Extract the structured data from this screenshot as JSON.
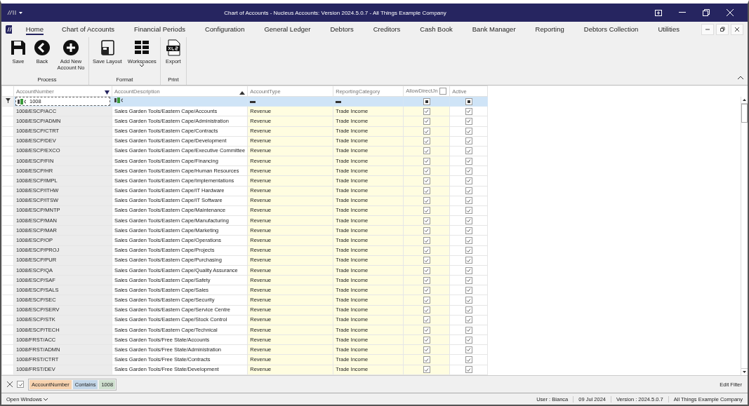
{
  "window": {
    "title": "Chart of Accounts - Nucleus Accounts: Version 2024.5.0.7 - All Things Example Company"
  },
  "menu_tabs": [
    {
      "label": "Home",
      "selected": true
    },
    {
      "label": "Chart of Accounts",
      "selected": false
    },
    {
      "label": "Financial Periods",
      "selected": false
    },
    {
      "label": "Configuration",
      "selected": false
    },
    {
      "label": "General Ledger",
      "selected": false
    },
    {
      "label": "Debtors",
      "selected": false
    },
    {
      "label": "Creditors",
      "selected": false
    },
    {
      "label": "Cash Book",
      "selected": false
    },
    {
      "label": "Bank Manager",
      "selected": false
    },
    {
      "label": "Reporting",
      "selected": false
    },
    {
      "label": "Debtors Collection",
      "selected": false
    },
    {
      "label": "Utilities",
      "selected": false
    }
  ],
  "ribbon_groups": [
    {
      "label": "Process",
      "buttons": [
        {
          "label": "Save",
          "dropdown": false
        },
        {
          "label": "Back",
          "dropdown": false
        },
        {
          "label": "Add New Account No",
          "dropdown": false
        }
      ]
    },
    {
      "label": "Format",
      "buttons": [
        {
          "label": "Save Layout",
          "dropdown": false
        },
        {
          "label": "Workspaces",
          "dropdown": true
        }
      ]
    },
    {
      "label": "Print",
      "buttons": [
        {
          "label": "Export",
          "dropdown": false
        }
      ]
    }
  ],
  "table": {
    "columns": [
      {
        "label": "AccountNumber",
        "filter": "1008",
        "filtered": true,
        "sorted": false
      },
      {
        "label": "AccountDescription",
        "filtered": false,
        "sorted": true
      },
      {
        "label": "AccountType",
        "filtered": false,
        "sorted": false
      },
      {
        "label": "ReportingCategory",
        "filtered": false,
        "sorted": false
      },
      {
        "label": "AllowDirectJn",
        "filtered": false,
        "sorted": false,
        "header_checkbox": {
          "checked": false
        },
        "filter_indeterminate": true
      },
      {
        "label": "Active",
        "filtered": false,
        "sorted": false,
        "filter_indeterminate": true
      }
    ],
    "rows": [
      {
        "number": "1008/ESCP/ACC",
        "description": "Sales Garden Tools/Eastern Cape/Accounts",
        "type": "Revenue",
        "category": "Trade Income",
        "allow_direct": true,
        "active": true
      },
      {
        "number": "1008/ESCP/ADMN",
        "description": "Sales Garden Tools/Eastern Cape/Administration",
        "type": "Revenue",
        "category": "Trade Income",
        "allow_direct": true,
        "active": true
      },
      {
        "number": "1008/ESCP/CTRT",
        "description": "Sales Garden Tools/Eastern Cape/Contracts",
        "type": "Revenue",
        "category": "Trade Income",
        "allow_direct": true,
        "active": true
      },
      {
        "number": "1008/ESCP/DEV",
        "description": "Sales Garden Tools/Eastern Cape/Development",
        "type": "Revenue",
        "category": "Trade Income",
        "allow_direct": true,
        "active": true
      },
      {
        "number": "1008/ESCP/EXCO",
        "description": "Sales Garden Tools/Eastern Cape/Executive Committee",
        "type": "Revenue",
        "category": "Trade Income",
        "allow_direct": true,
        "active": true
      },
      {
        "number": "1008/ESCP/FIN",
        "description": "Sales Garden Tools/Eastern Cape/Financing",
        "type": "Revenue",
        "category": "Trade Income",
        "allow_direct": true,
        "active": true
      },
      {
        "number": "1008/ESCP/HR",
        "description": "Sales Garden Tools/Eastern Cape/Human Resources",
        "type": "Revenue",
        "category": "Trade Income",
        "allow_direct": true,
        "active": true
      },
      {
        "number": "1008/ESCP/IMPL",
        "description": "Sales Garden Tools/Eastern Cape/Implementations",
        "type": "Revenue",
        "category": "Trade Income",
        "allow_direct": true,
        "active": true
      },
      {
        "number": "1008/ESCP/ITHW",
        "description": "Sales Garden Tools/Eastern Cape/IT Hardware",
        "type": "Revenue",
        "category": "Trade Income",
        "allow_direct": true,
        "active": true
      },
      {
        "number": "1008/ESCP/ITSW",
        "description": "Sales Garden Tools/Eastern Cape/IT Software",
        "type": "Revenue",
        "category": "Trade Income",
        "allow_direct": true,
        "active": true
      },
      {
        "number": "1008/ESCP/MNTP",
        "description": "Sales Garden Tools/Eastern Cape/Maintenance",
        "type": "Revenue",
        "category": "Trade Income",
        "allow_direct": true,
        "active": true
      },
      {
        "number": "1008/ESCP/MAN",
        "description": "Sales Garden Tools/Eastern Cape/Manufacturing",
        "type": "Revenue",
        "category": "Trade Income",
        "allow_direct": true,
        "active": true
      },
      {
        "number": "1008/ESCP/MAR",
        "description": "Sales Garden Tools/Eastern Cape/Marketing",
        "type": "Revenue",
        "category": "Trade Income",
        "allow_direct": true,
        "active": true
      },
      {
        "number": "1008/ESCP/OP",
        "description": "Sales Garden Tools/Eastern Cape/Operations",
        "type": "Revenue",
        "category": "Trade Income",
        "allow_direct": true,
        "active": true
      },
      {
        "number": "1008/ESCP/PROJ",
        "description": "Sales Garden Tools/Eastern Cape/Projects",
        "type": "Revenue",
        "category": "Trade Income",
        "allow_direct": true,
        "active": true
      },
      {
        "number": "1008/ESCP/PUR",
        "description": "Sales Garden Tools/Eastern Cape/Purchasing",
        "type": "Revenue",
        "category": "Trade Income",
        "allow_direct": true,
        "active": true
      },
      {
        "number": "1008/ESCP/QA",
        "description": "Sales Garden Tools/Eastern Cape/Quality Assurance",
        "type": "Revenue",
        "category": "Trade Income",
        "allow_direct": true,
        "active": true
      },
      {
        "number": "1008/ESCP/SAF",
        "description": "Sales Garden Tools/Eastern Cape/Safety",
        "type": "Revenue",
        "category": "Trade Income",
        "allow_direct": true,
        "active": true
      },
      {
        "number": "1008/ESCP/SALS",
        "description": "Sales Garden Tools/Eastern Cape/Sales",
        "type": "Revenue",
        "category": "Trade Income",
        "allow_direct": true,
        "active": true
      },
      {
        "number": "1008/ESCP/SEC",
        "description": "Sales Garden Tools/Eastern Cape/Security",
        "type": "Revenue",
        "category": "Trade Income",
        "allow_direct": true,
        "active": true
      },
      {
        "number": "1008/ESCP/SERV",
        "description": "Sales Garden Tools/Eastern Cape/Service Centre",
        "type": "Revenue",
        "category": "Trade Income",
        "allow_direct": true,
        "active": true
      },
      {
        "number": "1008/ESCP/STK",
        "description": "Sales Garden Tools/Eastern Cape/Stock Control",
        "type": "Revenue",
        "category": "Trade Income",
        "allow_direct": true,
        "active": true
      },
      {
        "number": "1008/ESCP/TECH",
        "description": "Sales Garden Tools/Eastern Cape/Technical",
        "type": "Revenue",
        "category": "Trade Income",
        "allow_direct": true,
        "active": true
      },
      {
        "number": "1008/FRST/ACC",
        "description": "Sales Garden Tools/Free State/Accounts",
        "type": "Revenue",
        "category": "Trade Income",
        "allow_direct": true,
        "active": true
      },
      {
        "number": "1008/FRST/ADMN",
        "description": "Sales Garden Tools/Free State/Administration",
        "type": "Revenue",
        "category": "Trade Income",
        "allow_direct": true,
        "active": true
      },
      {
        "number": "1008/FRST/CTRT",
        "description": "Sales Garden Tools/Free State/Contracts",
        "type": "Revenue",
        "category": "Trade Income",
        "allow_direct": true,
        "active": true
      },
      {
        "number": "1008/FRST/DEV",
        "description": "Sales Garden Tools/Free State/Development",
        "type": "Revenue",
        "category": "Trade Income",
        "allow_direct": true,
        "active": true
      }
    ]
  },
  "filter_bar": {
    "enabled": true,
    "field": "AccountNumber",
    "operator": "Contains",
    "value": "1008",
    "edit_label": "Edit Filter"
  },
  "status_bar": {
    "open_windows": "Open Windows",
    "user": "User : Bianca",
    "date": "09 Jul 2024",
    "version": "Version : 2024.5.0.7",
    "company": "All Things Example Company"
  }
}
